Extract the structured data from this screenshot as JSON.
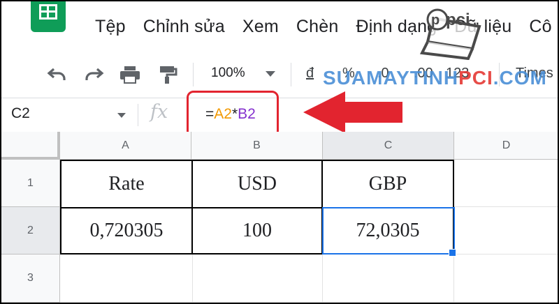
{
  "menu": {
    "items": [
      "Tệp",
      "Chỉnh sửa",
      "Xem",
      "Chèn",
      "Định dạng",
      "Dữ liệu",
      "Cô"
    ]
  },
  "toolbar": {
    "zoom": "100%",
    "currency": "đ",
    "percent": "%",
    "decimal": ".0",
    "decimal_more": ".00",
    "number_format": "123",
    "font": "Times"
  },
  "watermark": {
    "main": "SUAMAYTINH",
    "brand": "PCI",
    "suffix": ".COM",
    "logo_text": "pci"
  },
  "formula_bar": {
    "cell_ref": "C2",
    "fx_label": "fx",
    "formula_eq": "=",
    "formula_ref_a": "A2",
    "formula_op": "*",
    "formula_ref_b": "B2"
  },
  "sheet": {
    "columns": [
      "A",
      "B",
      "C",
      "D"
    ],
    "rows": [
      "1",
      "2",
      "3"
    ],
    "cells": {
      "A1": "Rate",
      "B1": "USD",
      "C1": "GBP",
      "A2": "0,720305",
      "B2": "100",
      "C2": "72,0305"
    },
    "selected_cell": "C2"
  },
  "colors": {
    "sheets_green": "#0f9d58",
    "selection_blue": "#1a73e8",
    "annotation_red": "#e2242f",
    "ref_a_color": "#f29900",
    "ref_b_color": "#8430ce"
  }
}
